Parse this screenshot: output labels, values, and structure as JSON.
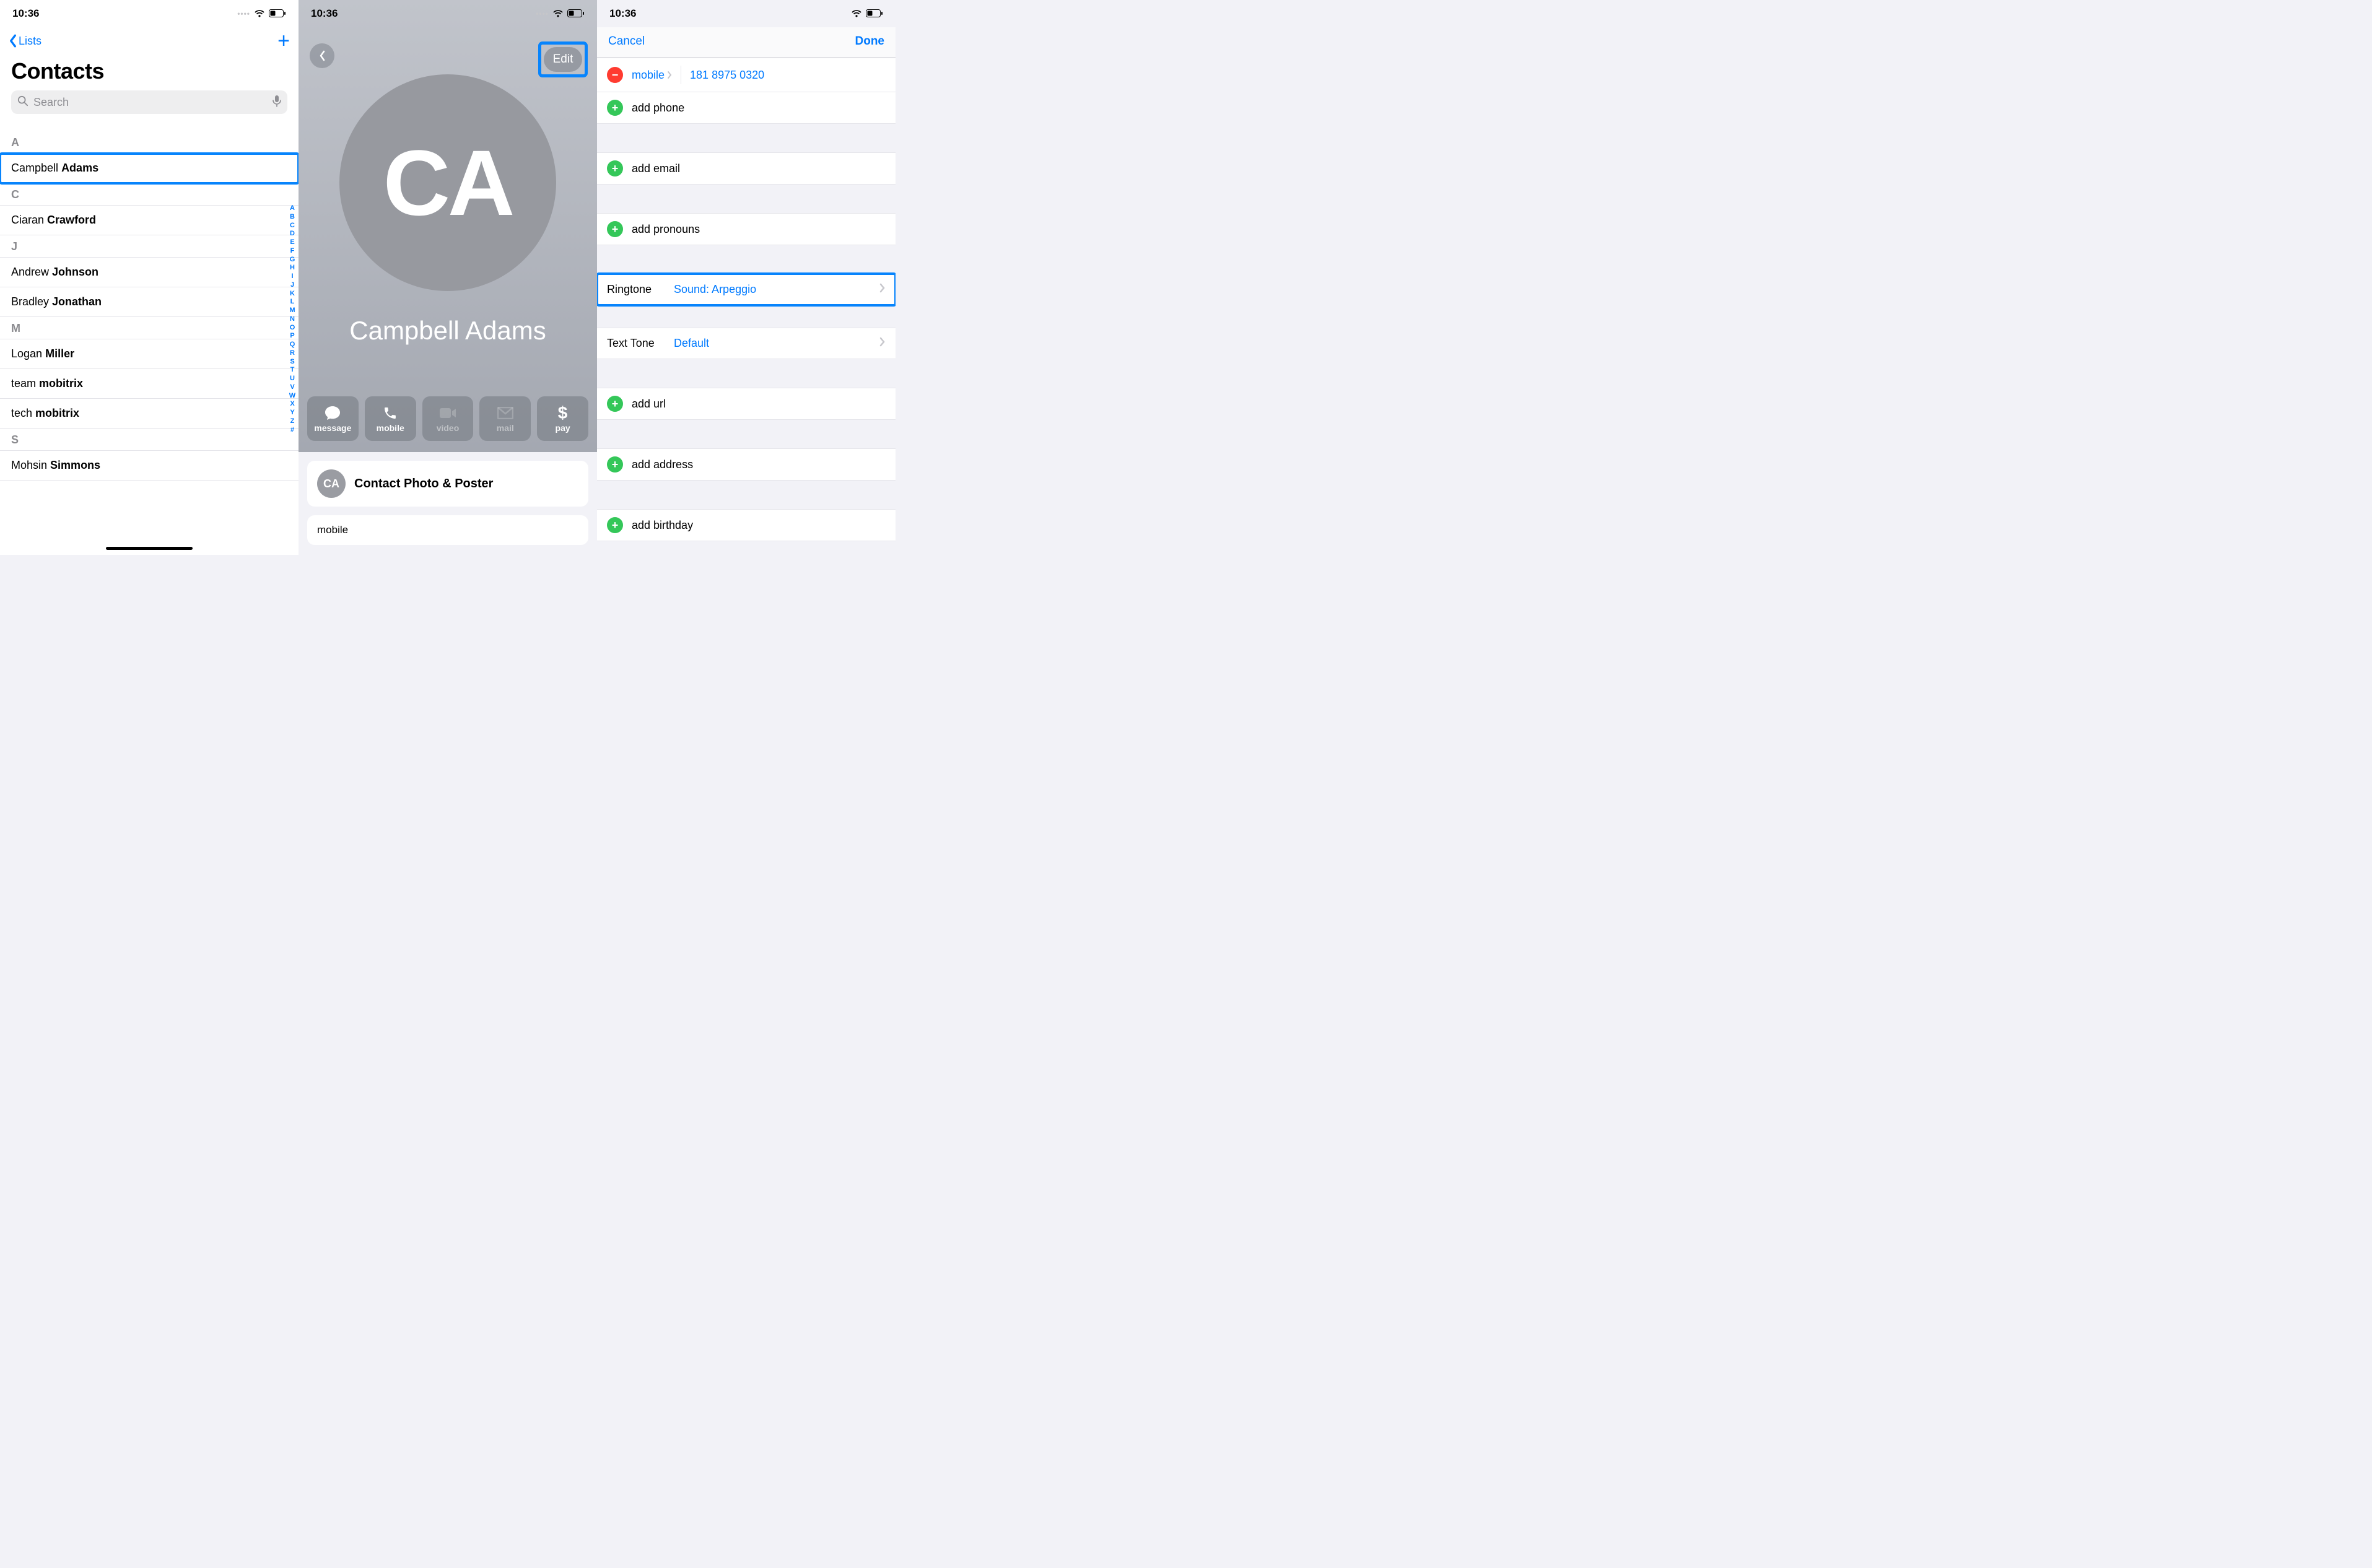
{
  "status": {
    "time": "10:36"
  },
  "screen1": {
    "back_label": "Lists",
    "title": "Contacts",
    "search_placeholder": "Search",
    "index": [
      "A",
      "B",
      "C",
      "D",
      "E",
      "F",
      "G",
      "H",
      "I",
      "J",
      "K",
      "L",
      "M",
      "N",
      "O",
      "P",
      "Q",
      "R",
      "S",
      "T",
      "U",
      "V",
      "W",
      "X",
      "Y",
      "Z",
      "#"
    ],
    "sections": [
      {
        "letter": "A",
        "contacts": [
          {
            "first": "Campbell",
            "last": "Adams",
            "highlight": true
          }
        ]
      },
      {
        "letter": "C",
        "contacts": [
          {
            "first": "Ciaran",
            "last": "Crawford"
          }
        ]
      },
      {
        "letter": "J",
        "contacts": [
          {
            "first": "Andrew",
            "last": "Johnson"
          },
          {
            "first": "Bradley",
            "last": "Jonathan"
          }
        ]
      },
      {
        "letter": "M",
        "contacts": [
          {
            "first": "Logan",
            "last": "Miller"
          },
          {
            "first": "team",
            "last": "mobitrix"
          },
          {
            "first": "tech",
            "last": "mobitrix"
          }
        ]
      },
      {
        "letter": "S",
        "contacts": [
          {
            "first": "Mohsin",
            "last": "Simmons"
          }
        ]
      }
    ]
  },
  "screen2": {
    "edit_label": "Edit",
    "initials": "CA",
    "name": "Campbell Adams",
    "actions": [
      {
        "key": "message",
        "label": "message",
        "enabled": true
      },
      {
        "key": "mobile",
        "label": "mobile",
        "enabled": true
      },
      {
        "key": "video",
        "label": "video",
        "enabled": false
      },
      {
        "key": "mail",
        "label": "mail",
        "enabled": false
      },
      {
        "key": "pay",
        "label": "pay",
        "enabled": true
      }
    ],
    "photo_poster": "Contact Photo & Poster",
    "field_label": "mobile"
  },
  "screen3": {
    "cancel": "Cancel",
    "done": "Done",
    "phone": {
      "label": "mobile",
      "value": "181 8975 0320"
    },
    "add_phone": "add phone",
    "add_email": "add email",
    "add_pronouns": "add pronouns",
    "ringtone": {
      "key": "Ringtone",
      "value": "Sound: Arpeggio"
    },
    "texttone": {
      "key": "Text Tone",
      "value": "Default"
    },
    "add_url": "add url",
    "add_address": "add address",
    "add_birthday": "add birthday"
  }
}
